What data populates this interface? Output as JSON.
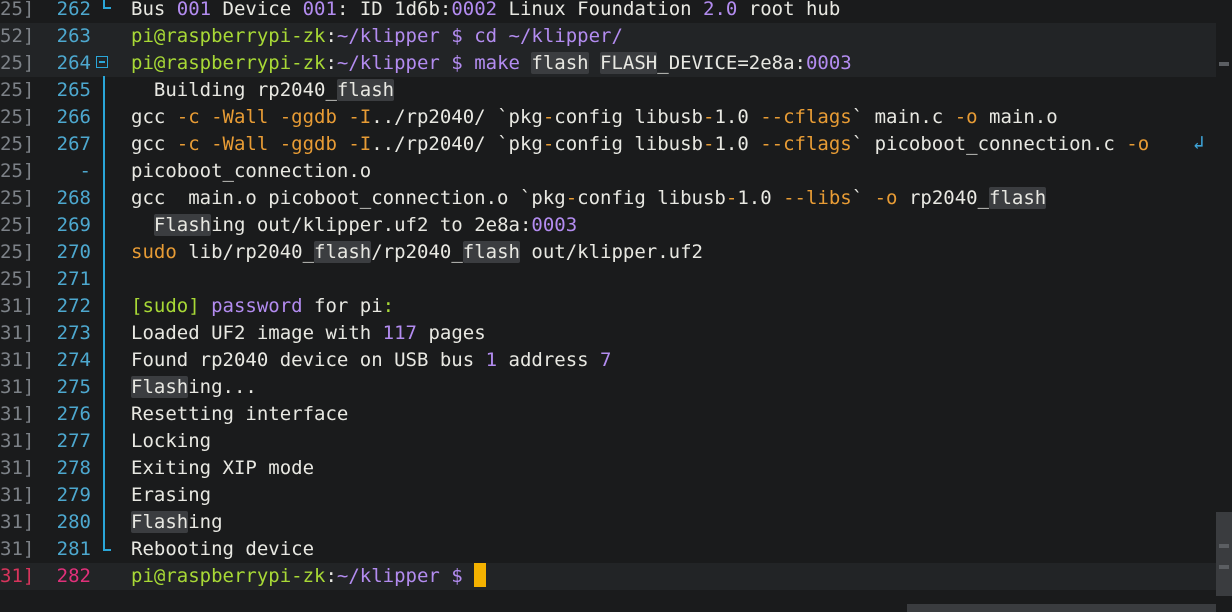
{
  "terminal": {
    "rows": [
      {
        "ts": "25]",
        "ln": "262",
        "segments": [
          {
            "t": "Bus ",
            "c": "w"
          },
          {
            "t": "001",
            "c": "p"
          },
          {
            "t": " Device ",
            "c": "w"
          },
          {
            "t": "001",
            "c": "p"
          },
          {
            "t": ": ID 1d6b",
            "c": "w"
          },
          {
            "t": ":",
            "c": "w"
          },
          {
            "t": "0002",
            "c": "p"
          },
          {
            "t": " Linux Foundation ",
            "c": "w"
          },
          {
            "t": "2.0",
            "c": "p"
          },
          {
            "t": " root hub",
            "c": "w"
          }
        ]
      },
      {
        "ts": "52]",
        "ln": "263",
        "segments": [
          {
            "t": "pi@raspberrypi-zk",
            "c": "g"
          },
          {
            "t": ":",
            "c": "w"
          },
          {
            "t": "~/klipper $ cd ~/klipper/",
            "c": "p"
          }
        ]
      },
      {
        "ts": "25]",
        "ln": "264",
        "segments": [
          {
            "t": "pi@raspberrypi-zk",
            "c": "g"
          },
          {
            "t": ":",
            "c": "w"
          },
          {
            "t": "~/klipper $ make ",
            "c": "p"
          },
          {
            "t": "flash",
            "c": "w",
            "hi": true
          },
          {
            "t": " ",
            "c": "w"
          },
          {
            "t": "FLASH",
            "c": "w",
            "hi": true
          },
          {
            "t": "_DEVICE=2e8a",
            "c": "w"
          },
          {
            "t": ":",
            "c": "w"
          },
          {
            "t": "0003",
            "c": "p"
          }
        ]
      },
      {
        "ts": "25]",
        "ln": "265",
        "segments": [
          {
            "t": "  Building rp2040_",
            "c": "w"
          },
          {
            "t": "flash",
            "c": "w",
            "hi": true
          }
        ]
      },
      {
        "ts": "25]",
        "ln": "266",
        "segments": [
          {
            "t": "gcc ",
            "c": "w"
          },
          {
            "t": "-c -Wall -ggdb -I",
            "c": "o"
          },
          {
            "t": "../rp2040/ `pkg",
            "c": "w"
          },
          {
            "t": "-",
            "c": "o"
          },
          {
            "t": "config libusb",
            "c": "w"
          },
          {
            "t": "-",
            "c": "o"
          },
          {
            "t": "1.0 ",
            "c": "w"
          },
          {
            "t": "--cflags",
            "c": "o"
          },
          {
            "t": "` main.c ",
            "c": "w"
          },
          {
            "t": "-o",
            "c": "o"
          },
          {
            "t": " main.o",
            "c": "w"
          }
        ]
      },
      {
        "ts": "25]",
        "ln": "267",
        "segments": [
          {
            "t": "gcc ",
            "c": "w"
          },
          {
            "t": "-c -Wall -ggdb -I",
            "c": "o"
          },
          {
            "t": "../rp2040/ `pkg",
            "c": "w"
          },
          {
            "t": "-",
            "c": "o"
          },
          {
            "t": "config libusb",
            "c": "w"
          },
          {
            "t": "-",
            "c": "o"
          },
          {
            "t": "1.0 ",
            "c": "w"
          },
          {
            "t": "--cflags",
            "c": "o"
          },
          {
            "t": "` picoboot_connection.c ",
            "c": "w"
          },
          {
            "t": "-o",
            "c": "o"
          }
        ]
      },
      {
        "ts": "25]",
        "ln": "-",
        "cont": true,
        "segments": [
          {
            "t": "picoboot_connection.o",
            "c": "w"
          }
        ]
      },
      {
        "ts": "25]",
        "ln": "268",
        "segments": [
          {
            "t": "gcc  main.o picoboot_connection.o `pkg",
            "c": "w"
          },
          {
            "t": "-",
            "c": "o"
          },
          {
            "t": "config libusb",
            "c": "w"
          },
          {
            "t": "-",
            "c": "o"
          },
          {
            "t": "1.0 ",
            "c": "w"
          },
          {
            "t": "--libs",
            "c": "o"
          },
          {
            "t": "` ",
            "c": "w"
          },
          {
            "t": "-o",
            "c": "o"
          },
          {
            "t": " rp2040_",
            "c": "w"
          },
          {
            "t": "flash",
            "c": "w",
            "hi": true
          }
        ]
      },
      {
        "ts": "25]",
        "ln": "269",
        "segments": [
          {
            "t": "  ",
            "c": "w"
          },
          {
            "t": "Flash",
            "c": "w",
            "hi": true
          },
          {
            "t": "ing out/klipper.uf2 to 2e8a",
            "c": "w"
          },
          {
            "t": ":",
            "c": "w"
          },
          {
            "t": "0003",
            "c": "p"
          }
        ]
      },
      {
        "ts": "25]",
        "ln": "270",
        "segments": [
          {
            "t": "sudo",
            "c": "o"
          },
          {
            "t": " lib/rp2040_",
            "c": "w"
          },
          {
            "t": "flash",
            "c": "w",
            "hi": true
          },
          {
            "t": "/rp2040_",
            "c": "w"
          },
          {
            "t": "flash",
            "c": "w",
            "hi": true
          },
          {
            "t": " out/klipper.uf2",
            "c": "w"
          }
        ]
      },
      {
        "ts": "25]",
        "ln": "271",
        "segments": []
      },
      {
        "ts": "31]",
        "ln": "272",
        "segments": [
          {
            "t": "[sudo]",
            "c": "g"
          },
          {
            "t": " password",
            "c": "p"
          },
          {
            "t": " for pi",
            "c": "w"
          },
          {
            "t": ":",
            "c": "g"
          }
        ]
      },
      {
        "ts": "31]",
        "ln": "273",
        "segments": [
          {
            "t": "Loaded UF2 image with ",
            "c": "w"
          },
          {
            "t": "117",
            "c": "p"
          },
          {
            "t": " pages",
            "c": "w"
          }
        ]
      },
      {
        "ts": "31]",
        "ln": "274",
        "segments": [
          {
            "t": "Found rp2040 device on USB bus ",
            "c": "w"
          },
          {
            "t": "1",
            "c": "p"
          },
          {
            "t": " address ",
            "c": "w"
          },
          {
            "t": "7",
            "c": "p"
          }
        ]
      },
      {
        "ts": "31]",
        "ln": "275",
        "segments": [
          {
            "t": "Flash",
            "c": "w",
            "hi": true
          },
          {
            "t": "ing...",
            "c": "w"
          }
        ]
      },
      {
        "ts": "31]",
        "ln": "276",
        "segments": [
          {
            "t": "Resetting interface",
            "c": "w"
          }
        ]
      },
      {
        "ts": "31]",
        "ln": "277",
        "segments": [
          {
            "t": "Locking",
            "c": "w"
          }
        ]
      },
      {
        "ts": "31]",
        "ln": "278",
        "segments": [
          {
            "t": "Exiting XIP mode",
            "c": "w"
          }
        ]
      },
      {
        "ts": "31]",
        "ln": "279",
        "segments": [
          {
            "t": "Erasing",
            "c": "w"
          }
        ]
      },
      {
        "ts": "31]",
        "ln": "280",
        "segments": [
          {
            "t": "Flash",
            "c": "w",
            "hi": true
          },
          {
            "t": "ing",
            "c": "w"
          }
        ]
      },
      {
        "ts": "31]",
        "ln": "281",
        "segments": [
          {
            "t": "Rebooting device",
            "c": "w"
          }
        ]
      },
      {
        "ts": "31]",
        "ln": "282",
        "current": true,
        "segments": [
          {
            "t": "pi@raspberrypi-zk",
            "c": "g"
          },
          {
            "t": ":",
            "c": "w"
          },
          {
            "t": "~/klipper $ ",
            "c": "p"
          }
        ]
      }
    ],
    "wrap_icon": "wrap-arrow-icon",
    "colors": {
      "background": "#1a1b1c",
      "prompt_user": "#a8d936",
      "prompt_path": "#b38cf0",
      "flag": "#e89c35",
      "line_number": "#4da8cf",
      "cursor": "#f4b100",
      "current_line_number": "#e0307a"
    }
  }
}
